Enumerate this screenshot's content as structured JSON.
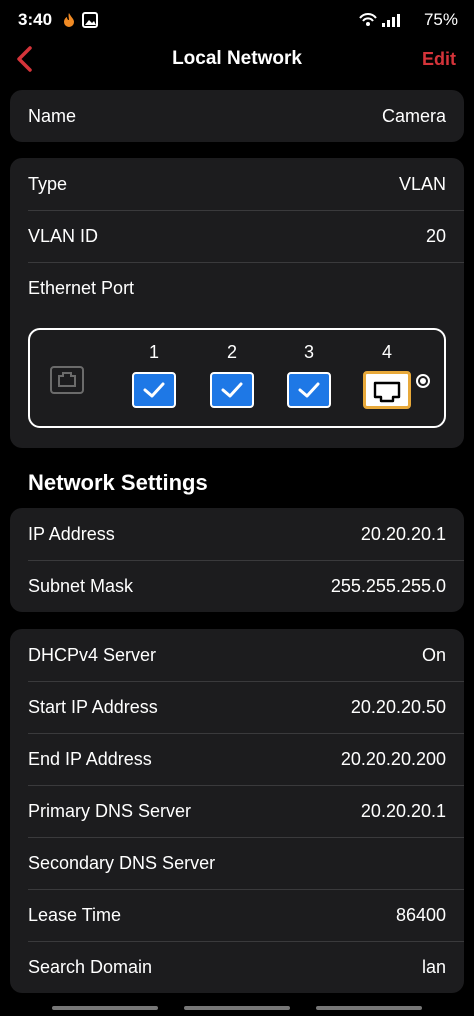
{
  "status_bar": {
    "time": "3:40",
    "battery": "75%"
  },
  "nav": {
    "title": "Local Network",
    "edit": "Edit"
  },
  "name_row": {
    "label": "Name",
    "value": "Camera"
  },
  "vlan_card": {
    "type_label": "Type",
    "type_value": "VLAN",
    "vlan_id_label": "VLAN ID",
    "vlan_id_value": "20",
    "ethernet_port_label": "Ethernet Port",
    "ports": [
      "1",
      "2",
      "3",
      "4"
    ]
  },
  "network_settings": {
    "title": "Network Settings",
    "ip_label": "IP Address",
    "ip_value": "20.20.20.1",
    "subnet_label": "Subnet Mask",
    "subnet_value": "255.255.255.0"
  },
  "dhcp": {
    "server_label": "DHCPv4 Server",
    "server_value": "On",
    "start_label": "Start IP Address",
    "start_value": "20.20.20.50",
    "end_label": "End IP Address",
    "end_value": "20.20.20.200",
    "primary_dns_label": "Primary DNS Server",
    "primary_dns_value": "20.20.20.1",
    "secondary_dns_label": "Secondary DNS Server",
    "secondary_dns_value": "",
    "lease_label": "Lease Time",
    "lease_value": "86400",
    "domain_label": "Search Domain",
    "domain_value": "lan"
  },
  "colors": {
    "accent": "#d5343a",
    "check_blue": "#1e78e6",
    "port_highlight": "#e8a93a"
  }
}
